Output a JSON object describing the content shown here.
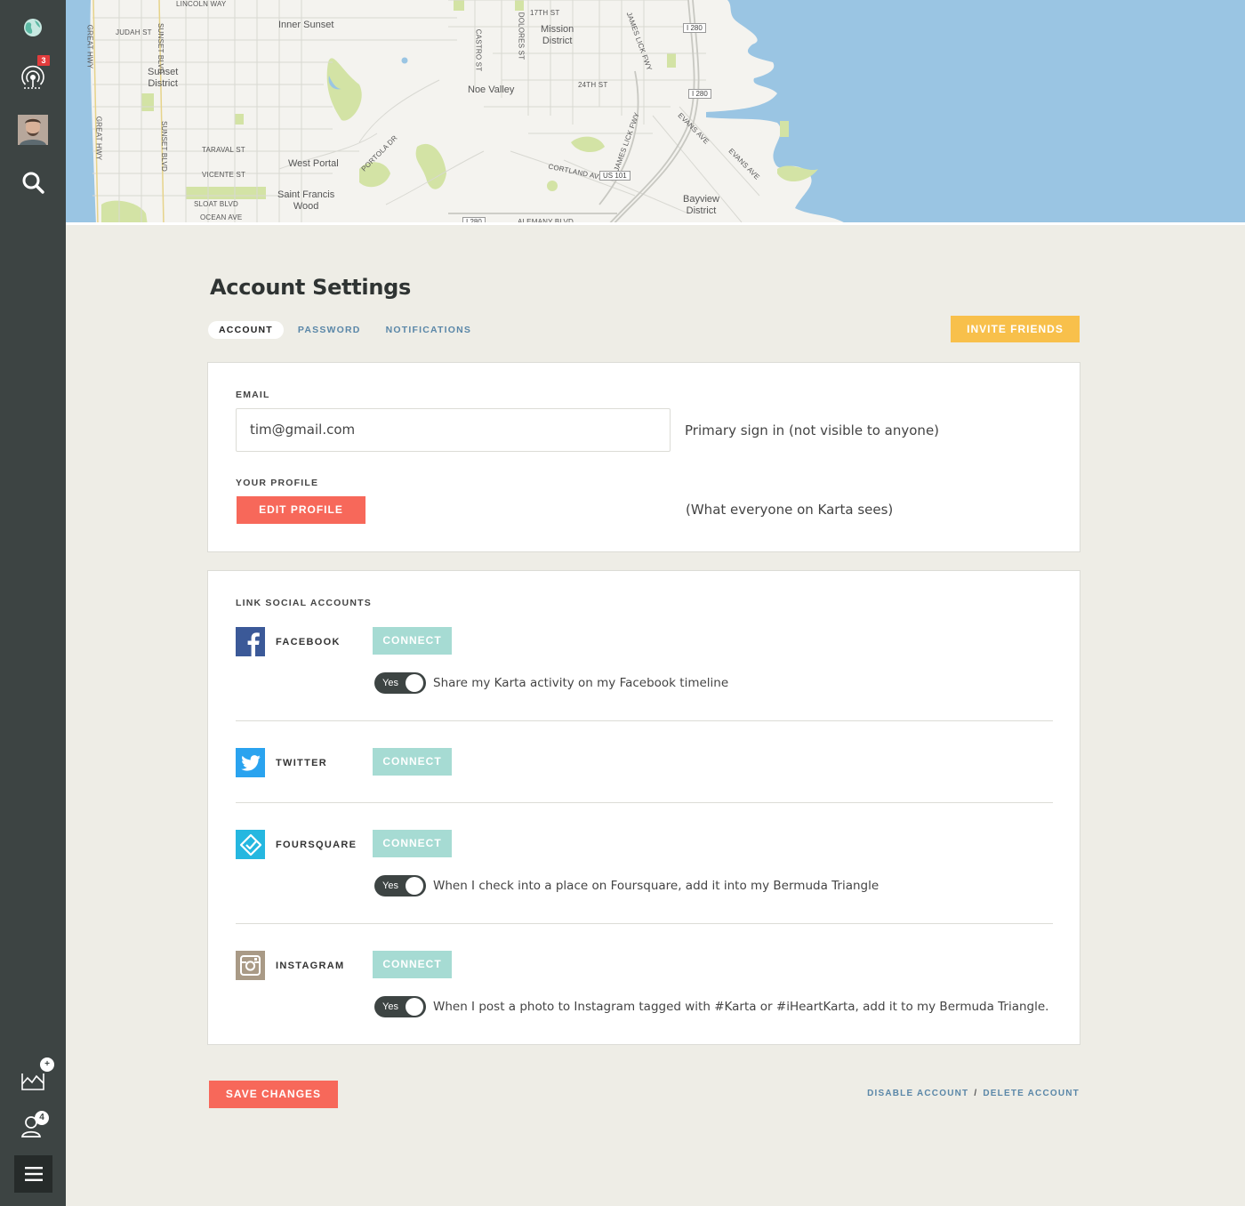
{
  "sidebar": {
    "notifications_count": "3",
    "friends_count": "4",
    "add_icon": "+"
  },
  "map": {
    "areas": [
      {
        "text": "Inner Sunset"
      },
      {
        "text": "Sunset\nDistrict"
      },
      {
        "text": "Mission\nDistrict"
      },
      {
        "text": "Noe Valley"
      },
      {
        "text": "West Portal"
      },
      {
        "text": "Saint Francis\nWood"
      },
      {
        "text": "Bayview\nDistrict"
      }
    ],
    "streets": [
      {
        "text": "LINCOLN WAY"
      },
      {
        "text": "JUDAH ST"
      },
      {
        "text": "TARAVAL ST"
      },
      {
        "text": "VICENTE ST"
      },
      {
        "text": "SLOAT BLVD"
      },
      {
        "text": "OCEAN AVE"
      },
      {
        "text": "24TH ST"
      },
      {
        "text": "17TH ST"
      },
      {
        "text": "CORTLAND AVE"
      },
      {
        "text": "PORTOLA DR"
      },
      {
        "text": "EVANS AVE"
      },
      {
        "text": "EVANS AVE"
      },
      {
        "text": "CASTRO ST"
      },
      {
        "text": "DOLORES ST"
      },
      {
        "text": "GREAT HWY"
      },
      {
        "text": "GREAT HWY"
      },
      {
        "text": "SUNSET BLVD"
      },
      {
        "text": "SUNSET BLVD"
      },
      {
        "text": "JAMES LICK FWY"
      },
      {
        "text": "JAMES LICK FWY"
      },
      {
        "text": "ALEMANY BLVD"
      }
    ],
    "shields": [
      {
        "text": "I 280"
      },
      {
        "text": "I 280"
      },
      {
        "text": "US 101"
      },
      {
        "text": "I 280"
      }
    ]
  },
  "page": {
    "title": "Account Settings",
    "tabs": [
      {
        "label": "ACCOUNT",
        "active": true
      },
      {
        "label": "PASSWORD",
        "active": false
      },
      {
        "label": "NOTIFICATIONS",
        "active": false
      }
    ],
    "invite_label": "INVITE FRIENDS"
  },
  "account": {
    "email_label": "EMAIL",
    "email_value": "tim@gmail.com",
    "email_hint": "Primary sign in (not visible to anyone)",
    "profile_label": "YOUR PROFILE",
    "edit_profile_label": "EDIT PROFILE",
    "profile_hint": "(What everyone on Karta sees)"
  },
  "social": {
    "section_label": "LINK SOCIAL ACCOUNTS",
    "connect_label": "CONNECT",
    "toggle_label": "Yes",
    "accounts": [
      {
        "name": "FACEBOOK",
        "color": "#3b5998",
        "toggle_text": "Share my Karta activity on my Facebook timeline"
      },
      {
        "name": "TWITTER",
        "color": "#2aa3ef",
        "toggle_text": ""
      },
      {
        "name": "FOURSQUARE",
        "color": "#25b7e0",
        "toggle_text": "When I check into a place on Foursquare, add it into my Bermuda Triangle"
      },
      {
        "name": "INSTAGRAM",
        "color": "#a99a86",
        "toggle_text": "When I post a photo to Instagram tagged with #Karta or #iHeartKarta, add it to my Bermuda Triangle."
      }
    ]
  },
  "footer": {
    "save_label": "SAVE CHANGES",
    "disable_label": "DISABLE ACCOUNT",
    "separator": "/",
    "delete_label": "DELETE ACCOUNT"
  },
  "colors": {
    "sidebar": "#3d4443",
    "accent_yellow": "#f8c04b",
    "accent_red": "#f7685a",
    "connect": "#a6dbd3",
    "link": "#5a87a8",
    "water": "#9ac5e3",
    "park": "#d3e3a5"
  }
}
